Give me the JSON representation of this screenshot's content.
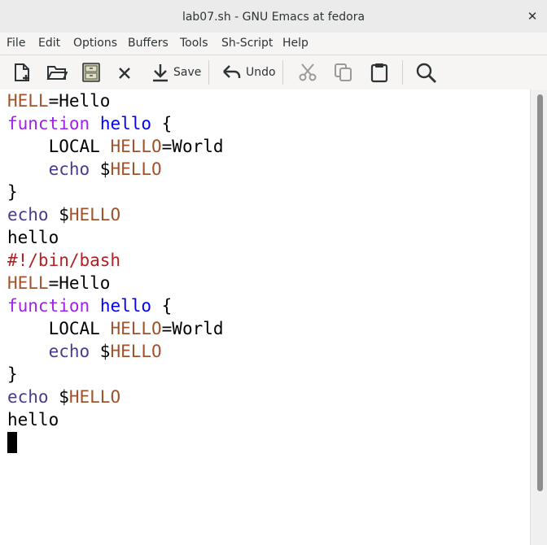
{
  "window": {
    "title": "lab07.sh - GNU Emacs at fedora",
    "close_glyph": "✕"
  },
  "menubar": {
    "items": [
      "File",
      "Edit",
      "Options",
      "Buffers",
      "Tools",
      "Sh-Script",
      "Help"
    ]
  },
  "toolbar": {
    "save_label": "Save",
    "undo_label": "Undo"
  },
  "editor": {
    "lines": [
      [
        {
          "t": "HELL",
          "c": "var"
        },
        {
          "t": "=Hello",
          "c": "plain"
        }
      ],
      [
        {
          "t": "function",
          "c": "kw"
        },
        {
          "t": " ",
          "c": "plain"
        },
        {
          "t": "hello",
          "c": "fn"
        },
        {
          "t": " {",
          "c": "plain"
        }
      ],
      [
        {
          "t": "    LOCAL ",
          "c": "plain"
        },
        {
          "t": "HELLO",
          "c": "var"
        },
        {
          "t": "=World",
          "c": "plain"
        }
      ],
      [
        {
          "t": "    ",
          "c": "plain"
        },
        {
          "t": "echo",
          "c": "bi"
        },
        {
          "t": " $",
          "c": "plain"
        },
        {
          "t": "HELLO",
          "c": "var"
        }
      ],
      [
        {
          "t": "}",
          "c": "plain"
        }
      ],
      [
        {
          "t": "echo",
          "c": "bi"
        },
        {
          "t": " $",
          "c": "plain"
        },
        {
          "t": "HELLO",
          "c": "var"
        }
      ],
      [
        {
          "t": "hello",
          "c": "plain"
        }
      ],
      [
        {
          "t": "#!/bin/bash",
          "c": "cm"
        }
      ],
      [
        {
          "t": "HELL",
          "c": "var"
        },
        {
          "t": "=Hello",
          "c": "plain"
        }
      ],
      [
        {
          "t": "function",
          "c": "kw"
        },
        {
          "t": " ",
          "c": "plain"
        },
        {
          "t": "hello",
          "c": "fn"
        },
        {
          "t": " {",
          "c": "plain"
        }
      ],
      [
        {
          "t": "    LOCAL ",
          "c": "plain"
        },
        {
          "t": "HELLO",
          "c": "var"
        },
        {
          "t": "=World",
          "c": "plain"
        }
      ],
      [
        {
          "t": "    ",
          "c": "plain"
        },
        {
          "t": "echo",
          "c": "bi"
        },
        {
          "t": " $",
          "c": "plain"
        },
        {
          "t": "HELLO",
          "c": "var"
        }
      ],
      [
        {
          "t": "}",
          "c": "plain"
        }
      ],
      [
        {
          "t": "echo",
          "c": "bi"
        },
        {
          "t": " $",
          "c": "plain"
        },
        {
          "t": "HELLO",
          "c": "var"
        }
      ],
      [
        {
          "t": "hello",
          "c": "plain"
        }
      ]
    ]
  }
}
